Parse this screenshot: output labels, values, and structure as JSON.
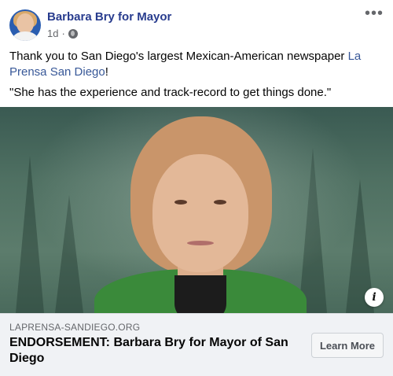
{
  "post": {
    "page_name": "Barbara Bry for Mayor",
    "timestamp": "1d",
    "separator": "·",
    "more_label": "•••",
    "text_line1_prefix": "Thank you to San Diego's largest Mexican-American newspaper ",
    "text_link": "La Prensa San Diego",
    "text_line1_suffix": "!",
    "text_line2": "\"She has the experience and track-record to get things done.\""
  },
  "image": {
    "info_label": "i"
  },
  "link_card": {
    "domain": "LAPRENSA-SANDIEGO.ORG",
    "headline": "ENDORSEMENT: Barbara Bry for Mayor of San Diego",
    "cta": "Learn More"
  },
  "colors": {
    "page_name": "#283c8e",
    "link": "#385898",
    "meta": "#65676b",
    "jacket": "#3a8a3a"
  },
  "icons": {
    "privacy": "globe-icon",
    "more": "ellipsis-icon",
    "info": "info-icon"
  }
}
